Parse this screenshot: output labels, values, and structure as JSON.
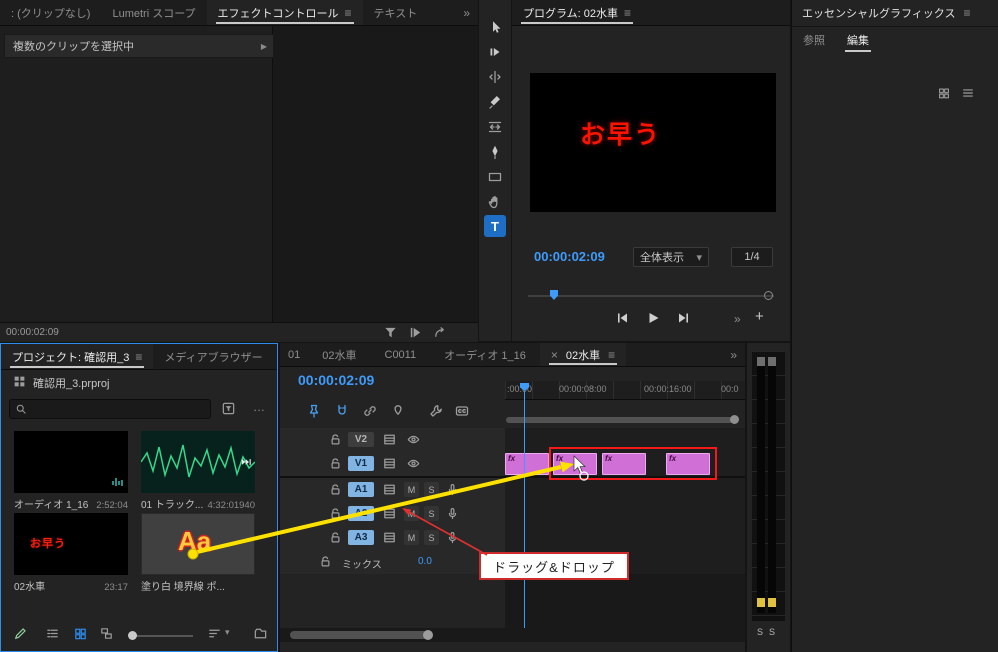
{
  "icons": {
    "menu": "≡",
    "overflow": "»",
    "close": "×",
    "expand": "▶",
    "caret": "▾",
    "more": "…",
    "add": "+"
  },
  "colors": {
    "accent_blue": "#2d8ceb",
    "timecode_blue": "#3f9bfa",
    "clip_pink": "#d06fd6",
    "selection_red": "#f31a1a",
    "arrow_yellow": "#ffe100",
    "title_red": "#fa1400"
  },
  "effect_controls": {
    "tabs": [
      {
        "label": ": (クリップなし)"
      },
      {
        "label": "Lumetri スコープ"
      },
      {
        "label": "エフェクトコントロール",
        "active": true
      },
      {
        "label": "テキスト"
      }
    ],
    "message": "複数のクリップを選択中",
    "timecode": "00:00:02:09"
  },
  "toolbar": {
    "tools": [
      "selection",
      "track-select-forward",
      "ripple-edit",
      "razor",
      "slip",
      "pen",
      "rectangle",
      "hand",
      "type"
    ],
    "type_tool_glyph": "T"
  },
  "program": {
    "tab": "プログラム: 02水車",
    "preview_text": "お早う",
    "timecode": "00:00:02:09",
    "fit_label": "全体表示",
    "resolution_label": "1/4"
  },
  "essential_graphics": {
    "title": "エッセンシャルグラフィックス",
    "tabs": [
      {
        "label": "参照"
      },
      {
        "label": "編集",
        "active": true
      }
    ]
  },
  "project": {
    "tabs": [
      {
        "label": "プロジェクト: 確認用_3",
        "active": true
      },
      {
        "label": "メディアブラウザー"
      }
    ],
    "file_name": "確認用_3.prproj",
    "items": [
      {
        "name": "オーディオ 1_16",
        "duration": "2:52:04"
      },
      {
        "name": "01 トラック...",
        "duration": "4:32:01940"
      },
      {
        "name": "02水車",
        "duration": "23:17",
        "thumb_text": "お早う"
      },
      {
        "name": "塗り白 境界線 ポ...",
        "duration": "",
        "thumb_text": "Aa"
      }
    ]
  },
  "timeline": {
    "tabs": [
      "01",
      "02水車",
      "C0011",
      "オーディオ 1_16"
    ],
    "active_tab": "02水車",
    "timecode": "00:00:02:09",
    "ruler_labels": [
      ":00:00",
      "00:00:08:00",
      "00:00:16:00",
      "00:0"
    ],
    "video_tracks": [
      {
        "name": "V2"
      },
      {
        "name": "V1"
      }
    ],
    "audio_tracks": [
      {
        "name": "A1"
      },
      {
        "name": "A2"
      },
      {
        "name": "A3"
      }
    ],
    "mix_name": "ミックス",
    "mix_level": "0.0",
    "mute_label": "M",
    "solo_label": "S",
    "clip_badge": "fx"
  },
  "annotation": {
    "label": "ドラッグ&ドロップ"
  },
  "meters": {
    "solo_left": "S",
    "solo_right": "S"
  }
}
